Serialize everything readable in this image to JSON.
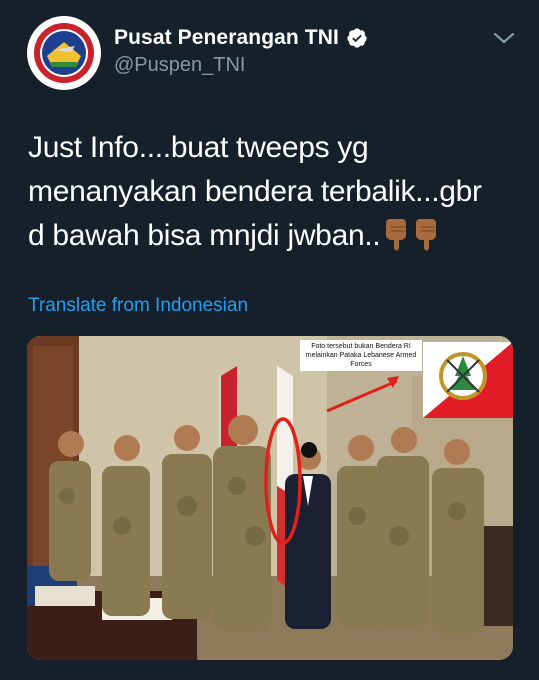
{
  "tweet": {
    "display_name": "Pusat Penerangan TNI",
    "handle": "@Puspen_TNI",
    "text_lines": [
      "Just Info....buat tweeps yg",
      "menanyakan bendera terbalik...gbr",
      "d bawah bisa mnjdi jwban.."
    ],
    "translate_label": "Translate from Indonesian"
  },
  "photo": {
    "caption_lines": [
      "Foto tersebut bukan Bendera RI",
      "melainkan Pataka Lebanese Armed",
      "Forces"
    ]
  },
  "icons": {
    "avatar": "puspen-tni-logo-icon",
    "verified": "verified-badge-icon",
    "menu": "chevron-down-icon",
    "emoji": "backhand-index-pointing-down-icon"
  },
  "colors": {
    "background": "#15202b",
    "text": "#ffffff",
    "secondary_text": "#8899a6",
    "link": "#1da1f2",
    "highlight": "#e0201b"
  }
}
